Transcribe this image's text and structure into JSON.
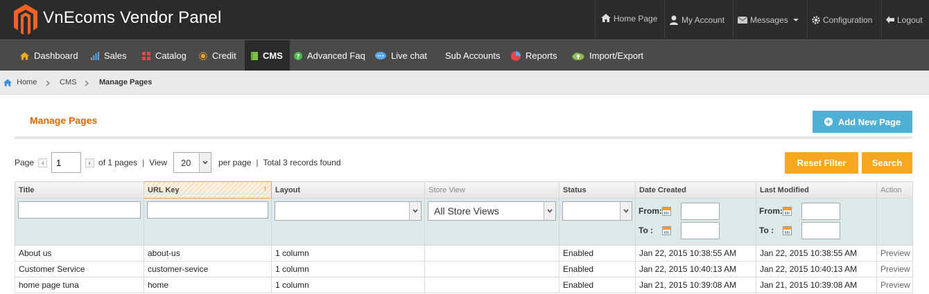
{
  "header": {
    "brand": "VnEcoms Vendor Panel",
    "nav": [
      {
        "label": "Home Page",
        "icon": "home-icon"
      },
      {
        "label": "My Account",
        "icon": "user-icon"
      },
      {
        "label": "Messages",
        "icon": "envelope-icon"
      },
      {
        "label": "Configuration",
        "icon": "gear-icon"
      },
      {
        "label": "Logout",
        "icon": "logout-icon"
      }
    ]
  },
  "main_nav": [
    {
      "label": "Dashboard",
      "icon": "home-icon"
    },
    {
      "label": "Sales",
      "icon": "bar-chart-icon"
    },
    {
      "label": "Catalog",
      "icon": "catalog-icon"
    },
    {
      "label": "Credit",
      "icon": "sun-icon"
    },
    {
      "label": "CMS",
      "icon": "book-icon",
      "active": true
    },
    {
      "label": "Advanced Faq",
      "icon": "help-icon"
    },
    {
      "label": "Live chat",
      "icon": "chat-icon"
    },
    {
      "label": "Sub Accounts",
      "icon": ""
    },
    {
      "label": "Reports",
      "icon": "pie-chart-icon"
    },
    {
      "label": "Import/Export",
      "icon": "cloud-icon"
    }
  ],
  "breadcrumb": {
    "home": "Home",
    "section": "CMS",
    "current": "Manage Pages"
  },
  "page": {
    "title": "Manage Pages",
    "add_button": "Add New Page"
  },
  "pager": {
    "page_label": "Page",
    "page_value": "1",
    "of_pages": "of 1 pages",
    "view_label": "View",
    "per_page_value": "20",
    "per_page_label": "per page",
    "total": "Total 3 records found",
    "reset_label": "Reset Filter",
    "search_label": "Search"
  },
  "grid": {
    "columns": [
      "Title",
      "URL Key",
      "Layout",
      "Store View",
      "Status",
      "Date Created",
      "Last Modified",
      "Action"
    ],
    "store_view_filter": "All Store Views",
    "date_from_label": "From:",
    "date_to_label": "To :",
    "rows": [
      [
        "About us",
        "about-us",
        "1 column",
        "",
        "Enabled",
        "Jan 22, 2015 10:38:55 AM",
        "Jan 22, 2015 10:38:55 AM",
        "Preview"
      ],
      [
        "Customer Service",
        "customer-sevice",
        "1 column",
        "",
        "Enabled",
        "Jan 22, 2015 10:40:13 AM",
        "Jan 22, 2015 10:40:13 AM",
        "Preview"
      ],
      [
        "home page tuna",
        "home",
        "1 column",
        "",
        "Enabled",
        "Jan 21, 2015 10:39:08 AM",
        "Jan 21, 2015 10:39:08 AM",
        "Preview"
      ]
    ]
  },
  "colors": {
    "accent_orange": "#e26703",
    "button_orange": "#f7a823",
    "button_blue": "#4fb0d6",
    "header_bg": "#2b2b2b",
    "nav_bg": "#4a4a4a"
  }
}
